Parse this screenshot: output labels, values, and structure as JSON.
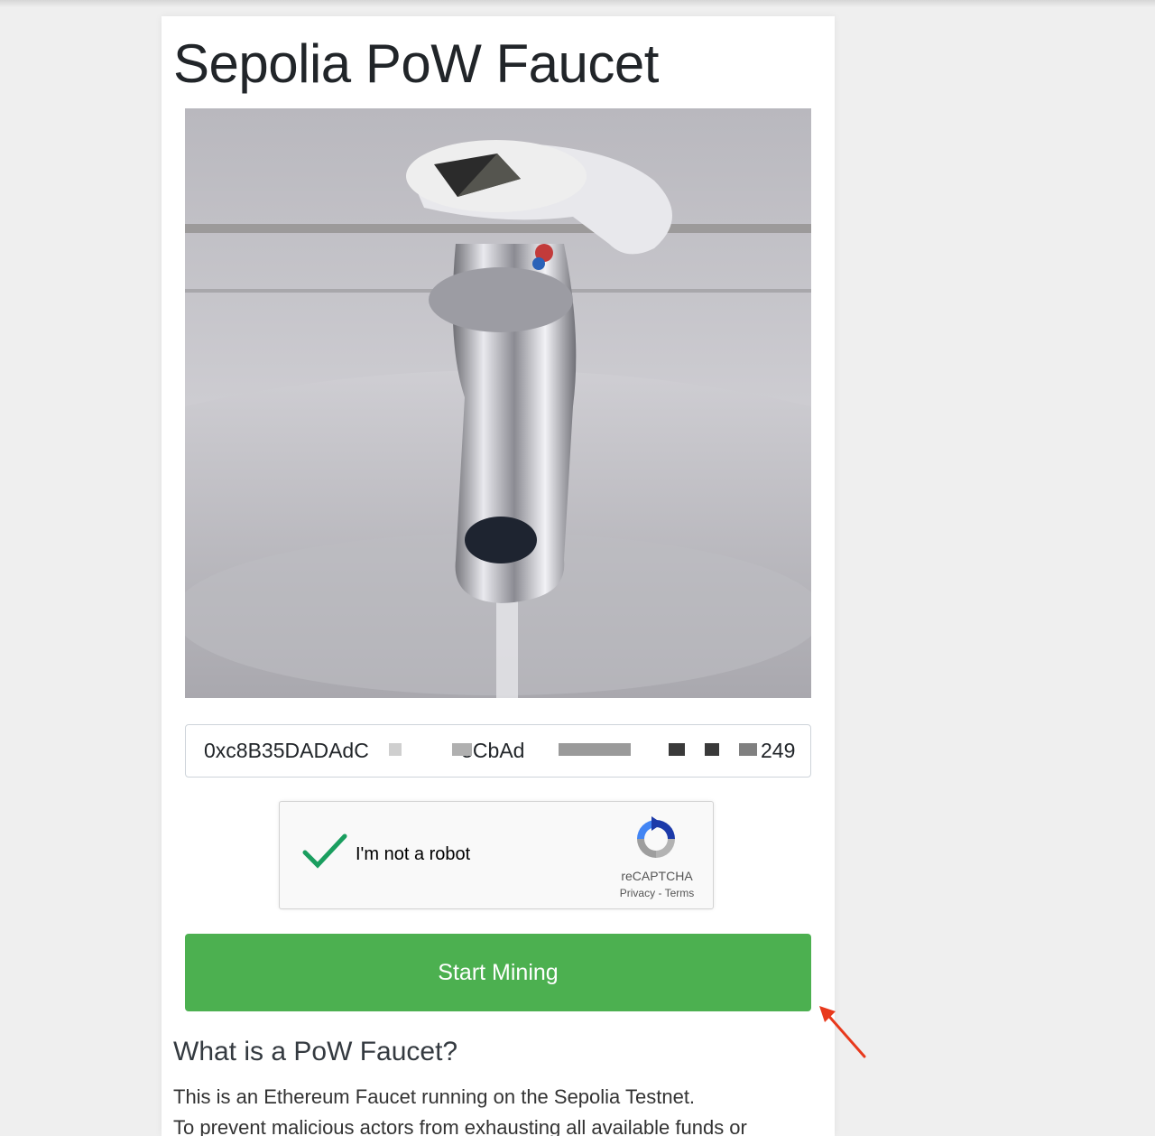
{
  "title": "Sepolia PoW Faucet",
  "hero_image": {
    "description": "faucet-with-ethereum-logo",
    "icon": "ethereum-icon"
  },
  "address": {
    "value": "0xc8B35DADAdC        3CbAd",
    "suffix": "249"
  },
  "captcha": {
    "label": "I'm not a robot",
    "brand": "reCAPTCHA",
    "privacy": "Privacy",
    "separator": " - ",
    "terms": "Terms",
    "checked": true
  },
  "button": {
    "label": "Start Mining",
    "color": "#4cb050"
  },
  "section": {
    "heading": "What is a PoW Faucet?",
    "paragraph1": "This is an Ethereum Faucet running on the Sepolia Testnet.",
    "paragraph2": "To prevent malicious actors from exhausting all available funds or"
  },
  "annotation": {
    "arrow_color": "#e8391c"
  }
}
